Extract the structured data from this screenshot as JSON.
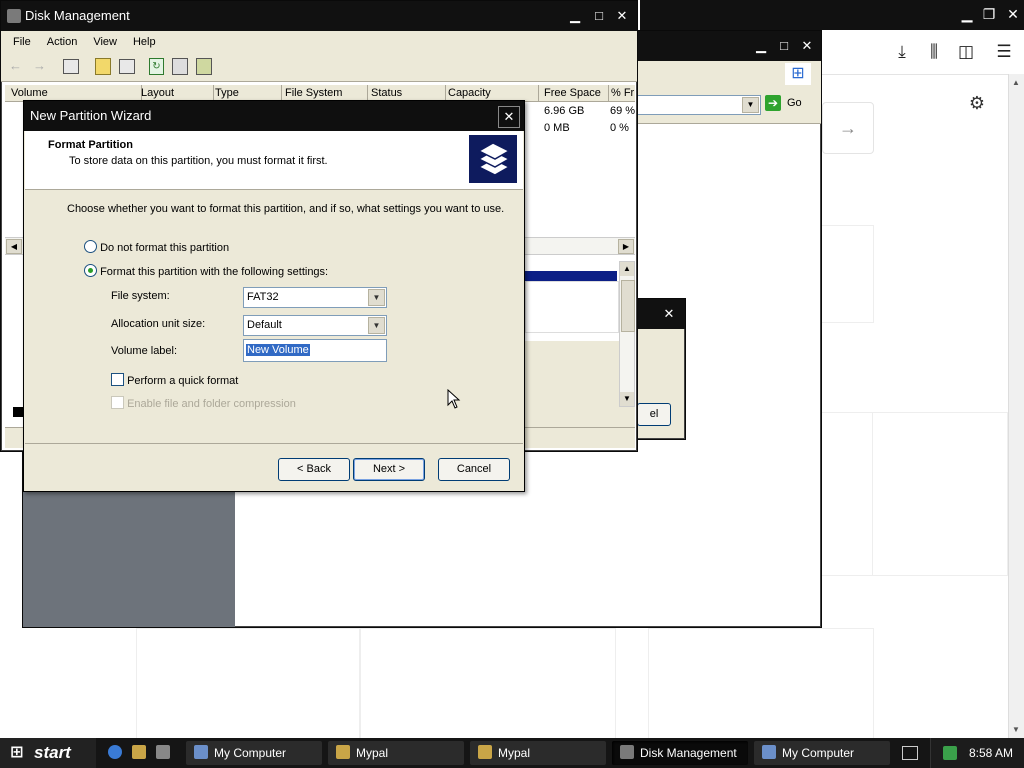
{
  "browser": {
    "go_label": "Go"
  },
  "disk_mgmt": {
    "title": "Disk Management",
    "menu": [
      "File",
      "Action",
      "View",
      "Help"
    ],
    "columns": [
      "Volume",
      "Layout",
      "Type",
      "File System",
      "Status",
      "Capacity",
      "Free Space",
      "% Fr"
    ],
    "rows": [
      {
        "free_space": "6.96 GB",
        "pct_free": "69 %"
      },
      {
        "free_space": "0 MB",
        "pct_free": "0 %"
      }
    ]
  },
  "wizard": {
    "title": "New Partition Wizard",
    "header_title": "Format Partition",
    "header_subtitle": "To store data on this partition, you must format it first.",
    "instruction": "Choose whether you want to format this partition, and if so, what settings you want to use.",
    "option_no_format": "Do not format this partition",
    "option_format": "Format this partition with the following settings:",
    "file_system_label": "File system:",
    "file_system_value": "FAT32",
    "alloc_label": "Allocation unit size:",
    "alloc_value": "Default",
    "volume_label_label": "Volume label:",
    "volume_label_value": "New Volume",
    "quick_format_label": "Perform a quick format",
    "compression_label": "Enable file and folder compression",
    "back_label": "< Back",
    "next_label": "Next >",
    "cancel_label": "Cancel"
  },
  "hidden_dialog": {
    "button_fragment": "el"
  },
  "taskbar": {
    "start_label": "start",
    "tasks": [
      "My Computer",
      "Mypal",
      "Mypal",
      "Disk Management",
      "My Computer"
    ],
    "clock": "8:58 AM"
  }
}
